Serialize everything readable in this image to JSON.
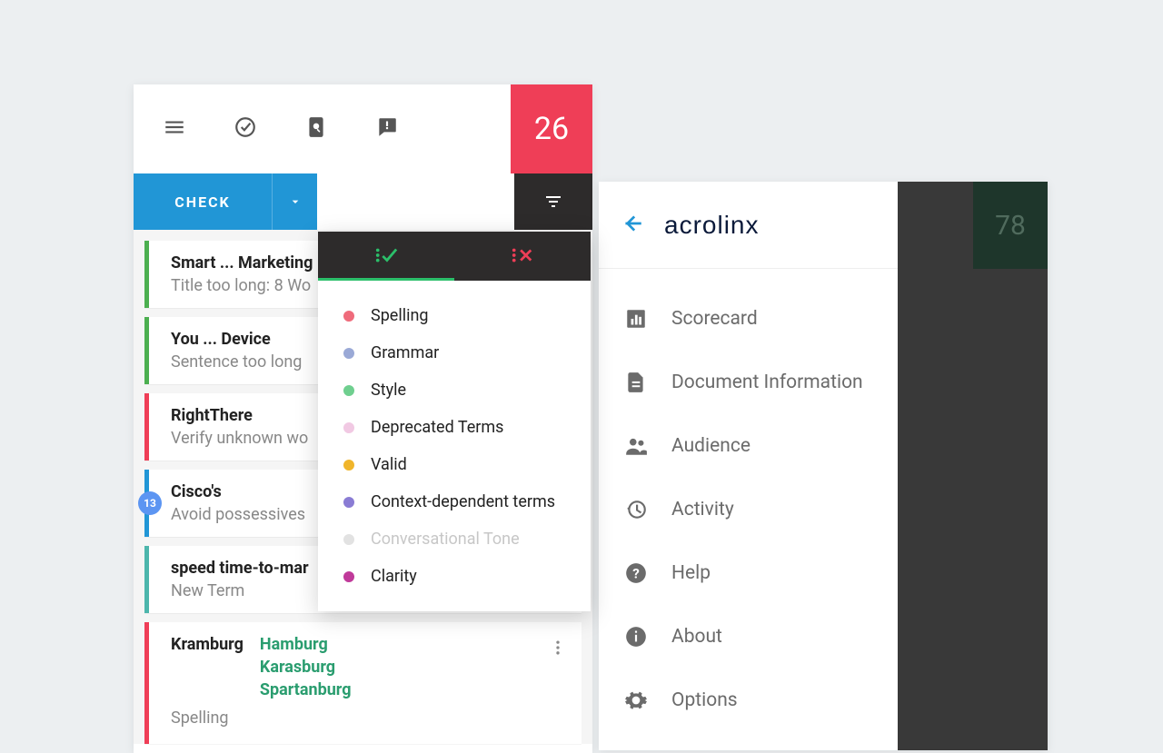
{
  "left": {
    "score": "26",
    "check_label": "CHECK",
    "issues": [
      {
        "style": "green",
        "title": "Smart ... Marketing",
        "sub": "Title too long: 8 Wo"
      },
      {
        "style": "green",
        "title": "You ... Device",
        "sub": "Sentence too long"
      },
      {
        "style": "red",
        "title": "RightThere",
        "sub": "Verify unknown wo"
      },
      {
        "style": "blue",
        "title": "Cisco's",
        "sub": "Avoid possessives",
        "badge": "13"
      },
      {
        "style": "bluegreen",
        "title": "speed time-to-mar",
        "sub": "New Term"
      }
    ],
    "kramburg": {
      "term": "Kramburg",
      "suggestions": [
        "Hamburg",
        "Karasburg",
        "Spartanburg"
      ],
      "category": "Spelling"
    }
  },
  "filters": [
    {
      "label": "Spelling",
      "color": "#ef6b7b"
    },
    {
      "label": "Grammar",
      "color": "#9aa9d6"
    },
    {
      "label": "Style",
      "color": "#6fcf8f"
    },
    {
      "label": "Deprecated Terms",
      "color": "#f1c9e3"
    },
    {
      "label": "Valid",
      "color": "#f0b52b"
    },
    {
      "label": "Context-dependent terms",
      "color": "#8a7cd4"
    },
    {
      "label": "Conversational Tone",
      "color": "#e2e2e2",
      "disabled": true
    },
    {
      "label": "Clarity",
      "color": "#c03a9a"
    }
  ],
  "right": {
    "score": "78",
    "brand": "acrolinx",
    "menu": [
      {
        "key": "scorecard",
        "label": "Scorecard"
      },
      {
        "key": "docinfo",
        "label": "Document Information"
      },
      {
        "key": "audience",
        "label": "Audience"
      },
      {
        "key": "activity",
        "label": "Activity"
      },
      {
        "key": "help",
        "label": "Help"
      },
      {
        "key": "about",
        "label": "About"
      },
      {
        "key": "options",
        "label": "Options"
      }
    ]
  }
}
